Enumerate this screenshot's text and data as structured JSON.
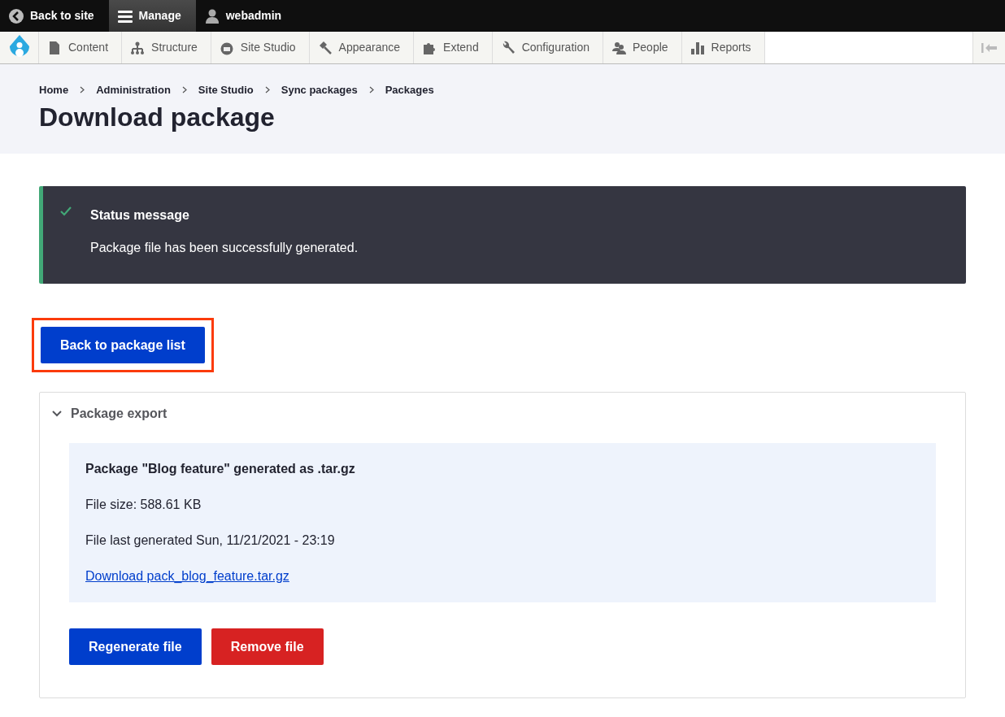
{
  "toolbar": {
    "items": [
      {
        "kind": "back",
        "label": "Back to site",
        "selected": false
      },
      {
        "kind": "menu",
        "label": "Manage",
        "selected": true
      },
      {
        "kind": "user",
        "label": "webadmin",
        "selected": false
      }
    ]
  },
  "admin_menu": {
    "items": [
      {
        "kind": "content",
        "label": "Content"
      },
      {
        "kind": "structure",
        "label": "Structure"
      },
      {
        "kind": "studio",
        "label": "Site Studio"
      },
      {
        "kind": "appearance",
        "label": "Appearance"
      },
      {
        "kind": "extend",
        "label": "Extend"
      },
      {
        "kind": "configuration",
        "label": "Configuration"
      },
      {
        "kind": "people",
        "label": "People"
      },
      {
        "kind": "reports",
        "label": "Reports"
      }
    ]
  },
  "breadcrumb": [
    "Home",
    "Administration",
    "Site Studio",
    "Sync packages",
    "Packages"
  ],
  "page_title": "Download package",
  "status": {
    "title": "Status message",
    "text": "Package file has been successfully generated."
  },
  "back_button": {
    "label": "Back to package list",
    "highlighted": true
  },
  "details": {
    "summary": "Package export",
    "expanded": true,
    "heading": "Package \"Blog feature\" generated as .tar.gz",
    "lines": [
      "File size: 588.61 KB",
      "File last generated Sun, 11/21/2021 - 23:19"
    ],
    "link": "Download pack_blog_feature.tar.gz"
  },
  "buttons": [
    {
      "kind": "primary",
      "label": "Regenerate file"
    },
    {
      "kind": "danger",
      "label": "Remove file"
    }
  ]
}
